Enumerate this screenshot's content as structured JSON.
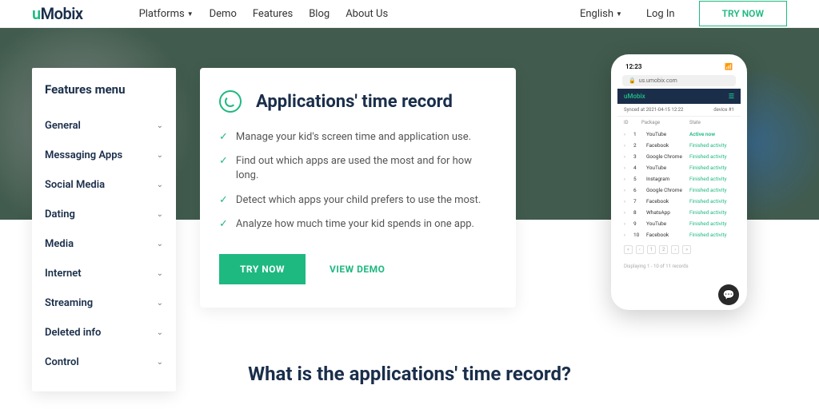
{
  "logo": {
    "u": "u",
    "mobix": "Mobix"
  },
  "nav": {
    "platforms": "Platforms",
    "demo": "Demo",
    "features": "Features",
    "blog": "Blog",
    "about": "About Us",
    "language": "English",
    "login": "Log In",
    "try_now": "TRY NOW"
  },
  "sidebar": {
    "title": "Features menu",
    "items": [
      {
        "label": "General"
      },
      {
        "label": "Messaging Apps"
      },
      {
        "label": "Social Media"
      },
      {
        "label": "Dating"
      },
      {
        "label": "Media"
      },
      {
        "label": "Internet"
      },
      {
        "label": "Streaming"
      },
      {
        "label": "Deleted info"
      },
      {
        "label": "Control"
      }
    ]
  },
  "card": {
    "title": "Applications' time record",
    "features": [
      "Manage your kid's screen time and application use.",
      "Find out which apps are used the most and for how long.",
      "Detect which apps your child prefers to use the most.",
      "Analyze how much time your kid spends in one app."
    ],
    "try_now": "TRY NOW",
    "view_demo": "VIEW DEMO"
  },
  "phone": {
    "time": "12:23",
    "url": "us.umobix.com",
    "brand": "uMobix",
    "sync": "Synced at 2021-04-15 12:22",
    "device": "device #1",
    "th_id": "ID",
    "th_pkg": "Package",
    "th_state": "State",
    "rows": [
      {
        "id": "1",
        "pkg": "YouTube",
        "state": "Active now",
        "active": true
      },
      {
        "id": "2",
        "pkg": "Facebook",
        "state": "Finished activity"
      },
      {
        "id": "3",
        "pkg": "Google Chrome",
        "state": "Finished activity"
      },
      {
        "id": "4",
        "pkg": "YouTube",
        "state": "Finished activity"
      },
      {
        "id": "5",
        "pkg": "Instagram",
        "state": "Finished activity"
      },
      {
        "id": "6",
        "pkg": "Google Chrome",
        "state": "Finished activity"
      },
      {
        "id": "7",
        "pkg": "Facebook",
        "state": "Finished activity"
      },
      {
        "id": "8",
        "pkg": "WhatsApp",
        "state": "Finished activity"
      },
      {
        "id": "9",
        "pkg": "YouTube",
        "state": "Finished activity"
      },
      {
        "id": "10",
        "pkg": "Facebook",
        "state": "Finished activity"
      }
    ],
    "pager": "Displaying 1 - 10 of 11 records"
  },
  "section_title": "What is the applications' time record?"
}
